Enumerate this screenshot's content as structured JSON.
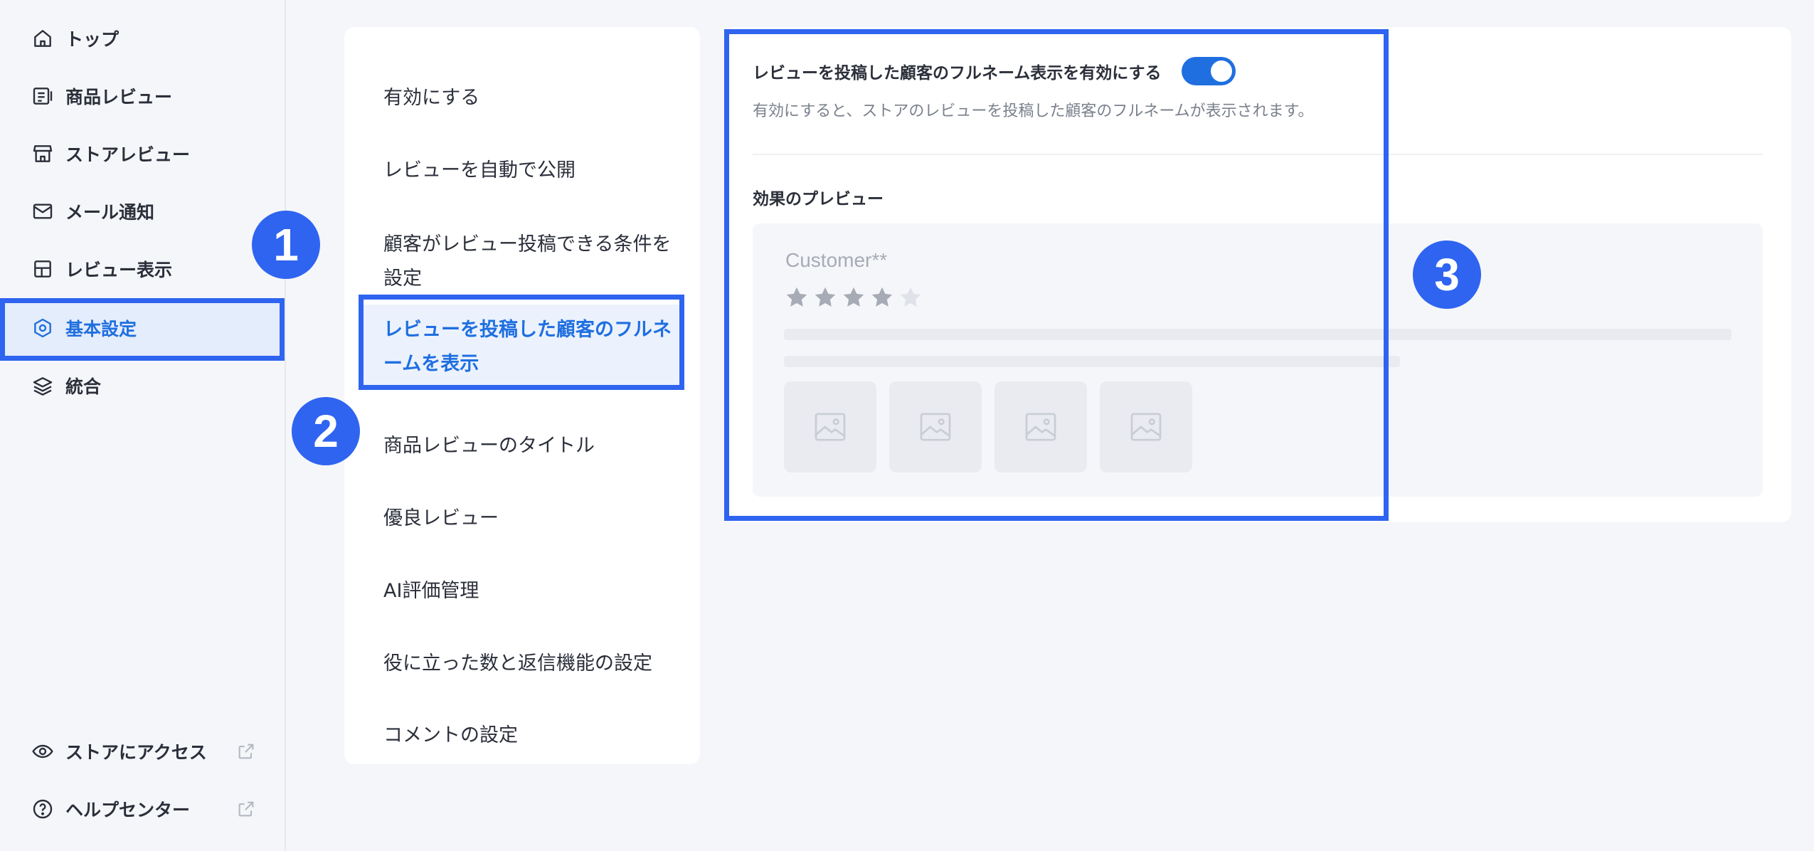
{
  "sidebar": {
    "items": [
      {
        "label": "トップ",
        "icon": "home-icon"
      },
      {
        "label": "商品レビュー",
        "icon": "product-review-icon"
      },
      {
        "label": "ストアレビュー",
        "icon": "store-icon"
      },
      {
        "label": "メール通知",
        "icon": "mail-icon"
      },
      {
        "label": "レビュー表示",
        "icon": "layout-icon"
      },
      {
        "label": "基本設定",
        "icon": "settings-hex-icon",
        "active": true
      },
      {
        "label": "統合",
        "icon": "layers-icon"
      }
    ],
    "bottom_items": [
      {
        "label": "ストアにアクセス",
        "icon": "eye-icon"
      },
      {
        "label": "ヘルプセンター",
        "icon": "help-icon"
      }
    ]
  },
  "menu": {
    "items": [
      {
        "label": "有効にする"
      },
      {
        "label": "レビューを自動で公開"
      },
      {
        "label": "顧客がレビュー投稿できる条件を設定"
      },
      {
        "label": "レビューを投稿した顧客のフルネームを表示",
        "active": true
      },
      {
        "label": "商品レビューのタイトル"
      },
      {
        "label": "優良レビュー"
      },
      {
        "label": "AI評価管理"
      },
      {
        "label": "役に立った数と返信機能の設定"
      },
      {
        "label": "コメントの設定"
      }
    ]
  },
  "content": {
    "toggle_label": "レビューを投稿した顧客のフルネーム表示を有効にする",
    "toggle_on": true,
    "description": "有効にすると、ストアのレビューを投稿した顧客のフルネームが表示されます。",
    "preview_title": "効果のプレビュー",
    "preview": {
      "customer_name": "Customer**",
      "rating": 4,
      "max_rating": 5
    }
  },
  "badges": [
    "1",
    "2",
    "3"
  ],
  "colors": {
    "accent": "#1f6fe0",
    "highlight": "#2f64f0",
    "active_bg": "#e4edfb"
  }
}
